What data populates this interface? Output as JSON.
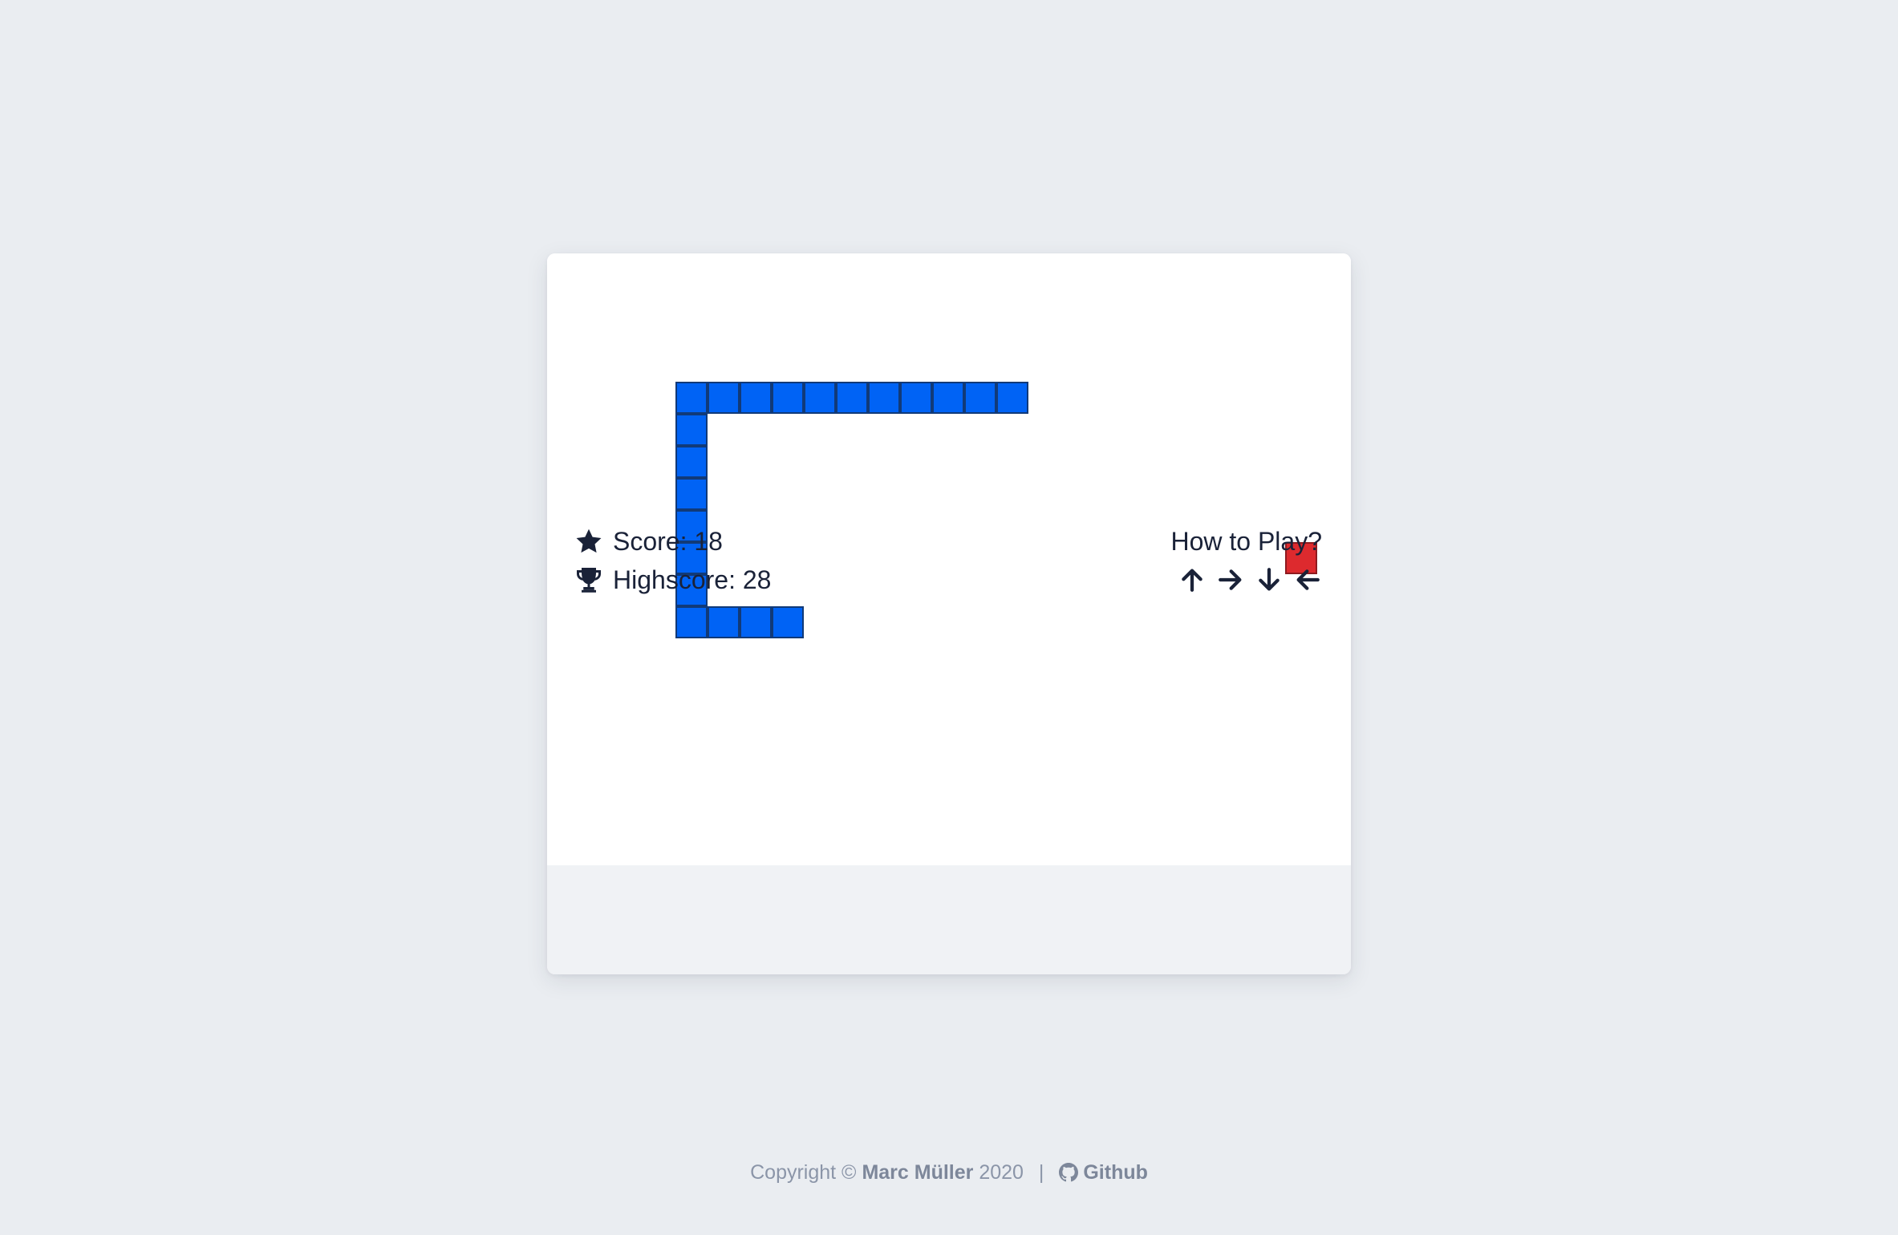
{
  "board": {
    "cols": 25,
    "rows": 19,
    "colors": {
      "snake": "#0063f5",
      "snake_border": "#113a78",
      "food": "#dd2a2e",
      "background": "#ffffff"
    },
    "snake": [
      [
        14,
        4
      ],
      [
        13,
        4
      ],
      [
        12,
        4
      ],
      [
        11,
        4
      ],
      [
        10,
        4
      ],
      [
        9,
        4
      ],
      [
        8,
        4
      ],
      [
        7,
        4
      ],
      [
        6,
        4
      ],
      [
        5,
        4
      ],
      [
        4,
        4
      ],
      [
        4,
        5
      ],
      [
        4,
        6
      ],
      [
        4,
        7
      ],
      [
        4,
        8
      ],
      [
        4,
        9
      ],
      [
        4,
        10
      ],
      [
        4,
        11
      ],
      [
        5,
        11
      ],
      [
        6,
        11
      ],
      [
        7,
        11
      ]
    ],
    "food": [
      23,
      9
    ]
  },
  "status": {
    "score_label": "Score: 18",
    "highscore_label": "Highscore: 28",
    "score_icon": "star-icon",
    "highscore_icon": "trophy-icon"
  },
  "help": {
    "label": "How to Play?",
    "keys": [
      "arrow-up-icon",
      "arrow-right-icon",
      "arrow-down-icon",
      "arrow-left-icon"
    ]
  },
  "footer": {
    "prefix": "Copyright ©",
    "author": "Marc Müller",
    "year": "2020",
    "separator": "|",
    "github_label": "Github",
    "github_icon": "github-icon"
  }
}
